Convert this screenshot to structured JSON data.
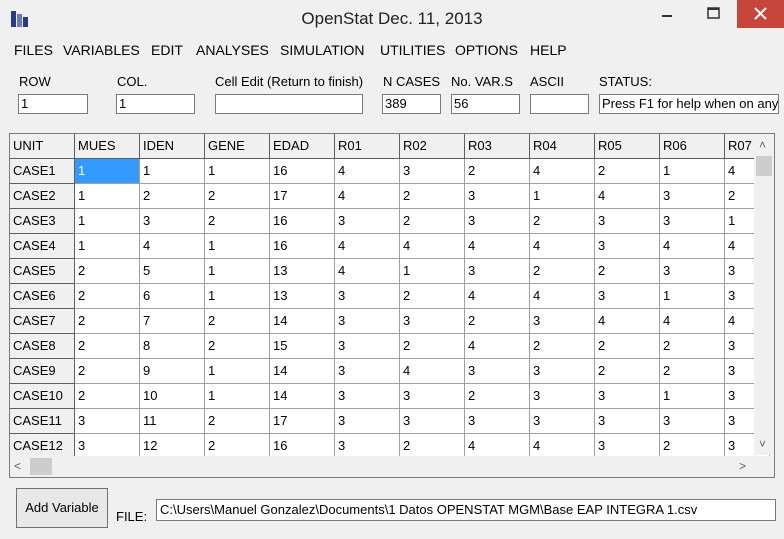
{
  "window": {
    "title": "OpenStat Dec. 11, 2013"
  },
  "menu": [
    "FILES",
    "VARIABLES",
    "EDIT",
    "ANALYSES",
    "SIMULATION",
    "UTILITIES",
    "OPTIONS",
    "HELP"
  ],
  "fields": {
    "row": {
      "label": "ROW",
      "value": "1"
    },
    "col": {
      "label": "COL.",
      "value": "1"
    },
    "cell_edit": {
      "label": "Cell Edit (Return to finish)",
      "value": ""
    },
    "n_cases": {
      "label": "N CASES",
      "value": "389"
    },
    "no_vars": {
      "label": "No. VAR.S",
      "value": "56"
    },
    "ascii": {
      "label": "ASCII",
      "value": ""
    },
    "status": {
      "label": "STATUS:",
      "value": "Press F1 for help when on any"
    }
  },
  "grid": {
    "headers": [
      "UNIT",
      "MUES",
      "IDEN",
      "GENE",
      "EDAD",
      "R01",
      "R02",
      "R03",
      "R04",
      "R05",
      "R06",
      "R07"
    ],
    "rows": [
      [
        "CASE1",
        "1",
        "1",
        "1",
        "16",
        "4",
        "3",
        "2",
        "4",
        "2",
        "1",
        "4"
      ],
      [
        "CASE2",
        "1",
        "2",
        "2",
        "17",
        "4",
        "2",
        "3",
        "1",
        "4",
        "3",
        "2"
      ],
      [
        "CASE3",
        "1",
        "3",
        "2",
        "16",
        "3",
        "2",
        "3",
        "2",
        "3",
        "3",
        "1"
      ],
      [
        "CASE4",
        "1",
        "4",
        "1",
        "16",
        "4",
        "4",
        "4",
        "4",
        "3",
        "4",
        "4"
      ],
      [
        "CASE5",
        "2",
        "5",
        "1",
        "13",
        "4",
        "1",
        "3",
        "2",
        "2",
        "3",
        "3"
      ],
      [
        "CASE6",
        "2",
        "6",
        "1",
        "13",
        "3",
        "2",
        "4",
        "4",
        "3",
        "1",
        "3"
      ],
      [
        "CASE7",
        "2",
        "7",
        "2",
        "14",
        "3",
        "3",
        "2",
        "3",
        "4",
        "4",
        "4"
      ],
      [
        "CASE8",
        "2",
        "8",
        "2",
        "15",
        "3",
        "2",
        "4",
        "2",
        "2",
        "2",
        "3"
      ],
      [
        "CASE9",
        "2",
        "9",
        "1",
        "14",
        "3",
        "4",
        "3",
        "3",
        "2",
        "2",
        "3"
      ],
      [
        "CASE10",
        "2",
        "10",
        "1",
        "14",
        "3",
        "3",
        "2",
        "3",
        "3",
        "1",
        "3"
      ],
      [
        "CASE11",
        "3",
        "11",
        "2",
        "17",
        "3",
        "3",
        "3",
        "3",
        "3",
        "3",
        "3"
      ],
      [
        "CASE12",
        "3",
        "12",
        "2",
        "16",
        "3",
        "2",
        "4",
        "4",
        "3",
        "2",
        "3"
      ]
    ]
  },
  "add_variable_label": "Add Variable",
  "file": {
    "label": "FILE:",
    "value": "C:\\Users\\Manuel Gonzalez\\Documents\\1 Datos OPENSTAT MGM\\Base EAP INTEGRA 1.csv"
  },
  "colors": {
    "selection": "#3399ff",
    "close_button": "#c7463c"
  }
}
